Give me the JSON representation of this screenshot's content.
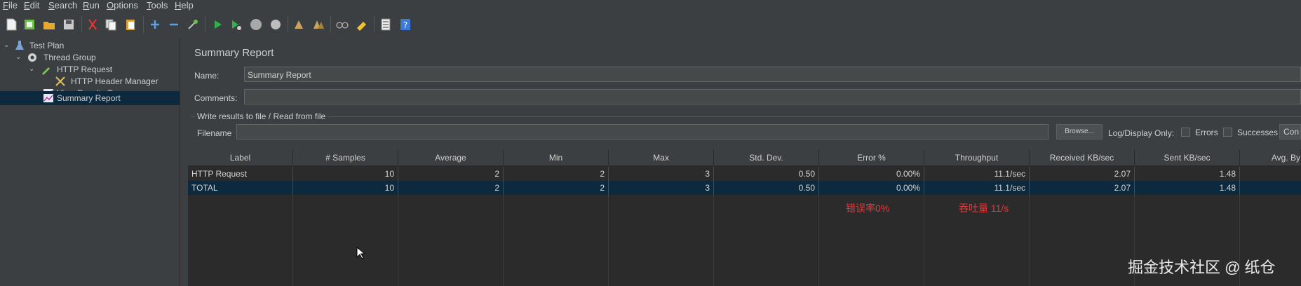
{
  "menu": [
    "File",
    "Edit",
    "Search",
    "Run",
    "Options",
    "Tools",
    "Help"
  ],
  "toolbar_icons": [
    "new-icon",
    "templates-icon",
    "open-icon",
    "save-icon",
    "cut-icon",
    "copy-icon",
    "paste-icon",
    "expand-icon",
    "collapse-icon",
    "toggle-icon",
    "start-icon",
    "start-no-pause-icon",
    "stop-icon",
    "shutdown-icon",
    "clear-icon",
    "clear-all-icon",
    "search-icon",
    "reset-search-icon",
    "function-helper-icon",
    "help-icon"
  ],
  "tree": {
    "items": [
      {
        "label": "Test Plan",
        "icon": "flask-icon"
      },
      {
        "label": "Thread Group",
        "icon": "gear-icon"
      },
      {
        "label": "HTTP Request",
        "icon": "pipette-icon"
      },
      {
        "label": "HTTP Header Manager",
        "icon": "tools-icon"
      },
      {
        "label": "View Results Tree",
        "icon": "graph-icon"
      },
      {
        "label": "Summary Report",
        "icon": "graph-icon"
      }
    ]
  },
  "panel": {
    "title": "Summary Report",
    "name_label": "Name:",
    "name_value": "Summary Report",
    "comments_label": "Comments:",
    "comments_value": "",
    "file_group_label": "Write results to file / Read from file",
    "filename_label": "Filename",
    "filename_value": "",
    "browse_label": "Browse...",
    "log_display_label": "Log/Display Only:",
    "errors_label": "Errors",
    "successes_label": "Successes",
    "configure_label": "Con"
  },
  "table": {
    "headers": [
      "Label",
      "# Samples",
      "Average",
      "Min",
      "Max",
      "Std. Dev.",
      "Error %",
      "Throughput",
      "Received KB/sec",
      "Sent KB/sec",
      "Avg. By"
    ],
    "rows": [
      [
        "HTTP Request",
        "10",
        "2",
        "2",
        "3",
        "0.50",
        "0.00%",
        "11.1/sec",
        "2.07",
        "1.48",
        ""
      ],
      [
        "TOTAL",
        "10",
        "2",
        "2",
        "3",
        "0.50",
        "0.00%",
        "11.1/sec",
        "2.07",
        "1.48",
        ""
      ]
    ]
  },
  "annotations": {
    "error_rate": "错误率0%",
    "throughput": "吞吐量 11/s"
  },
  "watermark": "掘金技术社区 @ 纸仓",
  "colors": {
    "background": "#3c3f41",
    "selection": "#0d293e",
    "annotation": "#e03a3a"
  }
}
